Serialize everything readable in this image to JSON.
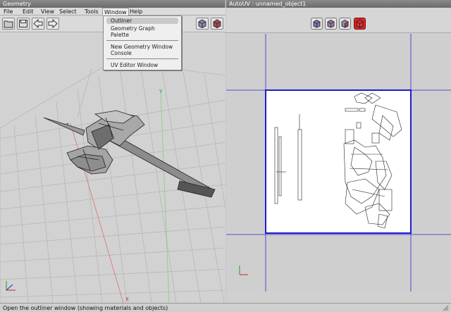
{
  "geometry_window": {
    "title": "Geometry",
    "menu": [
      "File",
      "Edit",
      "View",
      "Select",
      "Tools",
      "Window",
      "Help"
    ],
    "toolbar_icons": [
      "folder-icon",
      "save-icon",
      "arrow-left-icon",
      "arrow-right-icon",
      "cube-view-icon",
      "cube-red-faces-icon"
    ],
    "window_menu": {
      "items": [
        "Outliner",
        "Geometry Graph",
        "Palette",
        "New Geometry Window",
        "Console",
        "UV Editor Window"
      ],
      "highlighted": "Outliner"
    },
    "viewport": {
      "axis_labels": {
        "x": "X",
        "y": "Y",
        "z": "Z"
      }
    }
  },
  "autouv_window": {
    "title": "AutoUV : unnamed_object1",
    "toolbar_icons": [
      "cube-blue-icon",
      "cube-purple-icon",
      "cube-red-faces-icon",
      "cube-red-solid-icon"
    ],
    "active_mode": "cube-red-solid-icon"
  },
  "statusbar": {
    "text": "Open the outliner window (showing materials and objects)"
  },
  "colors": {
    "uv_border": "#1c1ccc",
    "active_button": "#cc2a2a",
    "grid_line": "#b4b4b4"
  }
}
